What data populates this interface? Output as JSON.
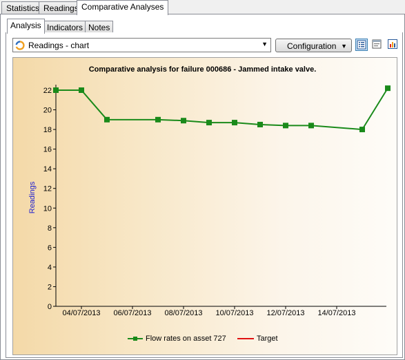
{
  "top_tabs": [
    "Statistics",
    "Readings",
    "Comparative Analyses"
  ],
  "inner_tabs": [
    "Analysis",
    "Indicators",
    "Notes"
  ],
  "toolbar": {
    "view_select": "Readings - chart",
    "config_label": "Configuration",
    "icons": [
      "list-view-icon",
      "form-view-icon",
      "chart-view-icon"
    ]
  },
  "colors": {
    "series": "#1a8a1a",
    "target": "#e01010",
    "ylabel": "#2020d0"
  },
  "chart_data": {
    "type": "line",
    "title": "Comparative analysis for failure 000686 - Jammed intake valve.",
    "xlabel": "",
    "ylabel": "Readings",
    "ylim": [
      0,
      22
    ],
    "yticks": [
      "0",
      "2",
      "4",
      "6",
      "8",
      "10",
      "12",
      "14",
      "16",
      "18",
      "20",
      "22"
    ],
    "xticks": [
      "04/07/2013",
      "06/07/2013",
      "08/07/2013",
      "10/07/2013",
      "12/07/2013",
      "14/07/2013"
    ],
    "xlim": [
      "2013-07-03",
      "2013-07-15"
    ],
    "series": [
      {
        "name": "Flow rates on asset 727",
        "x": [
          "2013-07-03",
          "2013-07-04",
          "2013-07-05",
          "2013-07-07",
          "2013-07-08",
          "2013-07-09",
          "2013-07-10",
          "2013-07-11",
          "2013-07-12",
          "2013-07-13",
          "2013-07-15",
          "2013-07-16"
        ],
        "values": [
          22,
          22,
          19,
          19,
          18.9,
          18.7,
          18.7,
          18.5,
          18.4,
          18.4,
          18,
          22.2
        ]
      },
      {
        "name": "Target",
        "x": [],
        "values": []
      }
    ],
    "legend": "bottom"
  }
}
